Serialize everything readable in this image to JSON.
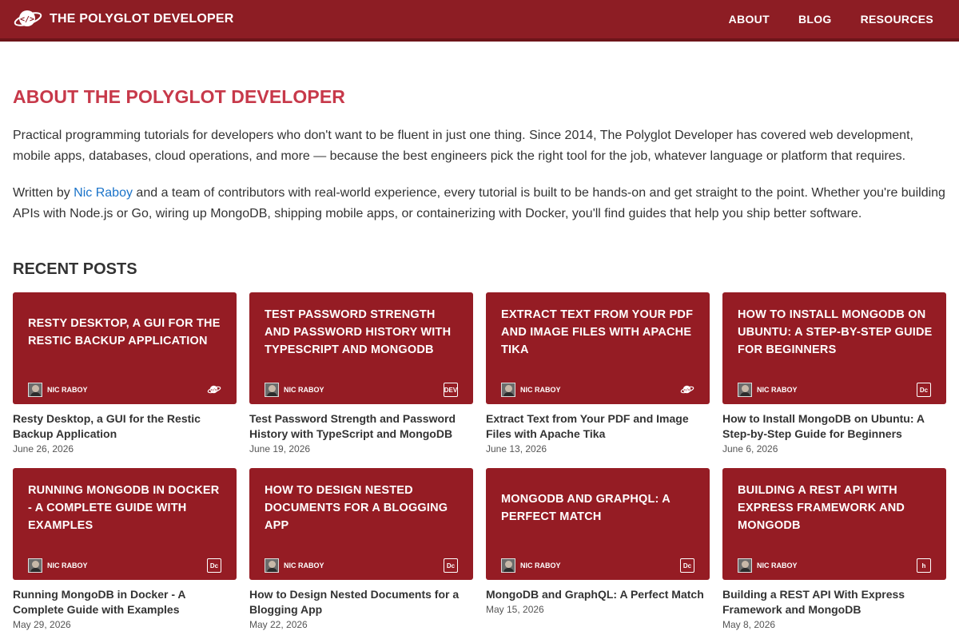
{
  "header": {
    "brand": "THE POLYGLOT DEVELOPER",
    "nav": [
      {
        "label": "ABOUT"
      },
      {
        "label": "BLOG"
      },
      {
        "label": "RESOURCES"
      }
    ]
  },
  "about": {
    "title": "ABOUT THE POLYGLOT DEVELOPER",
    "paragraph1": "Practical programming tutorials for developers who don't want to be fluent in just one thing. Since 2014, The Polyglot Developer has covered web development, mobile apps, databases, cloud operations, and more — because the best engineers pick the right tool for the job, whatever language or platform that requires.",
    "paragraph2_prefix": "Written by ",
    "author_link": "Nic Raboy",
    "paragraph2_suffix": " and a team of contributors with real-world experience, every tutorial is built to be hands-on and get straight to the point. Whether you're building APIs with Node.js or Go, wiring up MongoDB, shipping mobile apps, or containerizing with Docker, you'll find guides that help you ship better software."
  },
  "recent": {
    "title": "RECENT POSTS",
    "posts": [
      {
        "thumb_title": "RESTY DESKTOP, A GUI FOR THE RESTIC BACKUP APPLICATION",
        "author": "NIC RABOY",
        "badge": "polyglot-logo-icon",
        "badge_text": "",
        "title": "Resty Desktop, a GUI for the Restic Backup Application",
        "date": "June 26, 2026"
      },
      {
        "thumb_title": "TEST PASSWORD STRENGTH AND PASSWORD HISTORY WITH TYPESCRIPT AND MONGODB",
        "author": "NIC RABOY",
        "badge": "dev-icon",
        "badge_text": "DEV",
        "title": "Test Password Strength and Password History with TypeScript and MongoDB",
        "date": "June 19, 2026"
      },
      {
        "thumb_title": "EXTRACT TEXT FROM YOUR PDF AND IMAGE FILES WITH APACHE TIKA",
        "author": "NIC RABOY",
        "badge": "polyglot-logo-icon",
        "badge_text": "",
        "title": "Extract Text from Your PDF and Image Files with Apache Tika",
        "date": "June 13, 2026"
      },
      {
        "thumb_title": "HOW TO INSTALL MONGODB ON UBUNTU: A STEP-BY-STEP GUIDE FOR BEGINNERS",
        "author": "NIC RABOY",
        "badge": "dc-icon",
        "badge_text": "D̶c",
        "title": "How to Install MongoDB on Ubuntu: A Step-by-Step Guide for Beginners",
        "date": "June 6, 2026"
      },
      {
        "thumb_title": "RUNNING MONGODB IN DOCKER - A COMPLETE GUIDE WITH EXAMPLES",
        "author": "NIC RABOY",
        "badge": "dc-icon",
        "badge_text": "Dc",
        "title": "Running MongoDB in Docker - A Complete Guide with Examples",
        "date": "May 29, 2026"
      },
      {
        "thumb_title": "HOW TO DESIGN NESTED DOCUMENTS FOR A BLOGGING APP",
        "author": "NIC RABOY",
        "badge": "dc-icon",
        "badge_text": "Dc",
        "title": "How to Design Nested Documents for a Blogging App",
        "date": "May 22, 2026"
      },
      {
        "thumb_title": "MONGODB AND GRAPHQL: A PERFECT MATCH",
        "author": "NIC RABOY",
        "badge": "dc-icon",
        "badge_text": "Dc",
        "title": "MongoDB and GraphQL: A Perfect Match",
        "date": "May 15, 2026"
      },
      {
        "thumb_title": "BUILDING A REST API WITH EXPRESS FRAMEWORK AND MONGODB",
        "author": "NIC RABOY",
        "badge": "hashnode-icon",
        "badge_text": "h",
        "title": "Building a REST API With Express Framework and MongoDB",
        "date": "May 8, 2026"
      }
    ]
  },
  "colors": {
    "header_bg": "#8d1d24",
    "accent_title": "#c7394a",
    "thumb_bg": "#951c24",
    "link": "#1a73c9"
  }
}
